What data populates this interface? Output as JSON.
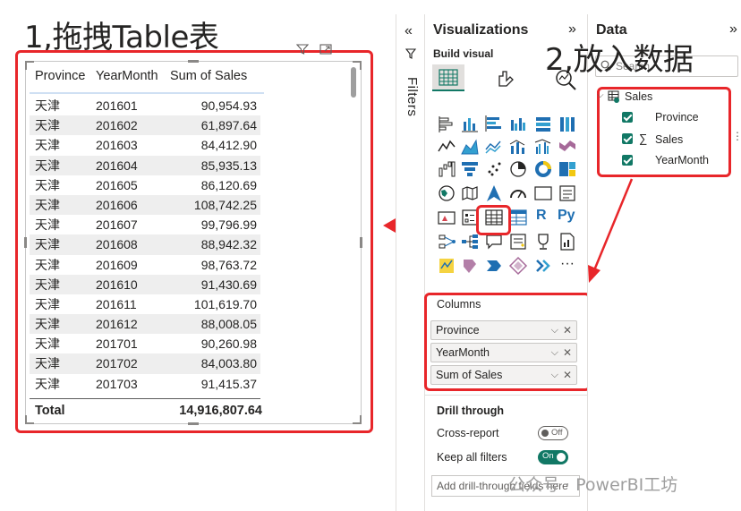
{
  "annotations": {
    "step1": "1,拖拽Table表",
    "step2": "2,放入数据"
  },
  "table": {
    "headers": [
      "Province",
      "YearMonth",
      "Sum of Sales"
    ],
    "rows": [
      [
        "天津",
        "201601",
        "90,954.93"
      ],
      [
        "天津",
        "201602",
        "61,897.64"
      ],
      [
        "天津",
        "201603",
        "84,412.90"
      ],
      [
        "天津",
        "201604",
        "85,935.13"
      ],
      [
        "天津",
        "201605",
        "86,120.69"
      ],
      [
        "天津",
        "201606",
        "108,742.25"
      ],
      [
        "天津",
        "201607",
        "99,796.99"
      ],
      [
        "天津",
        "201608",
        "88,942.32"
      ],
      [
        "天津",
        "201609",
        "98,763.72"
      ],
      [
        "天津",
        "201610",
        "91,430.69"
      ],
      [
        "天津",
        "201611",
        "101,619.70"
      ],
      [
        "天津",
        "201612",
        "88,008.05"
      ],
      [
        "天津",
        "201701",
        "90,260.98"
      ],
      [
        "天津",
        "201702",
        "84,003.80"
      ],
      [
        "天津",
        "201703",
        "91,415.37"
      ]
    ],
    "total_label": "Total",
    "total_value": "14,916,807.64"
  },
  "filters": {
    "label": "Filters"
  },
  "visualizations": {
    "title": "Visualizations",
    "build_visual_label": "Build visual",
    "columns_label": "Columns",
    "wells": [
      "Province",
      "YearMonth",
      "Sum of Sales"
    ],
    "drill_through_label": "Drill through",
    "cross_report_label": "Cross-report",
    "cross_report_toggle": "Off",
    "keep_filters_label": "Keep all filters",
    "keep_filters_toggle": "On",
    "drill_placeholder": "Add drill-through fields here",
    "r_label": "R",
    "py_label": "Py",
    "num_label": "123",
    "more_label": "···"
  },
  "data_pane": {
    "title": "Data",
    "search_placeholder": "Search",
    "table_name": "Sales",
    "fields": [
      "Province",
      "Sales",
      "YearMonth"
    ]
  },
  "watermark": "公众号 · PowerBI工坊",
  "colors": {
    "accent_red": "#e8262a",
    "check_green": "#117865",
    "row_stripe": "#eeeeee"
  }
}
